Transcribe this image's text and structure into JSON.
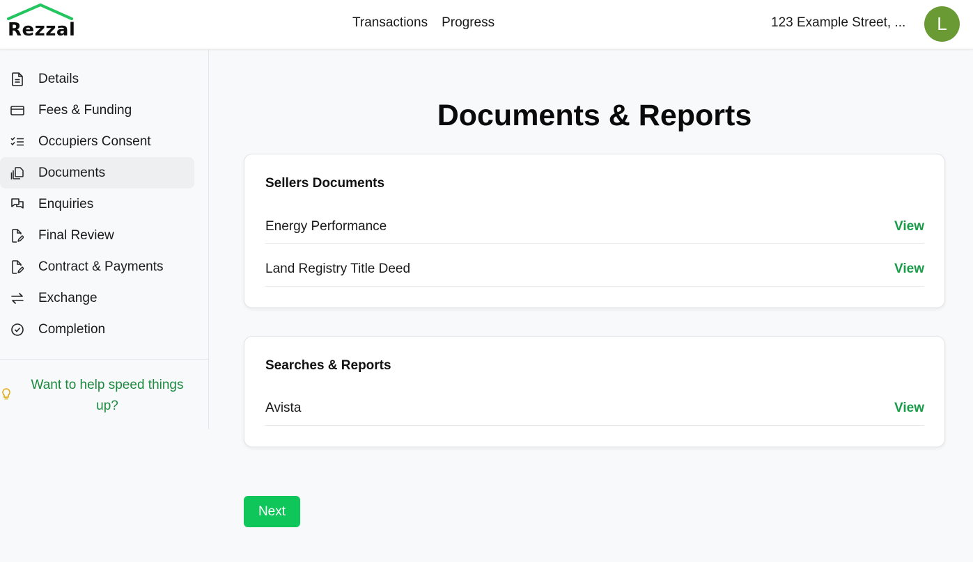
{
  "header": {
    "logo_text": "Rezzal",
    "nav": [
      "Transactions",
      "Progress"
    ],
    "address": "123 Example Street, ...",
    "avatar_initial": "L"
  },
  "sidebar": {
    "items": [
      {
        "label": "Details",
        "icon": "document-icon"
      },
      {
        "label": "Fees & Funding",
        "icon": "credit-card-icon"
      },
      {
        "label": "Occupiers Consent",
        "icon": "checklist-icon"
      },
      {
        "label": "Documents",
        "icon": "documents-icon",
        "active": true
      },
      {
        "label": "Enquiries",
        "icon": "chat-icon"
      },
      {
        "label": "Final Review",
        "icon": "edit-document-icon"
      },
      {
        "label": "Contract & Payments",
        "icon": "edit-document-icon"
      },
      {
        "label": "Exchange",
        "icon": "exchange-arrows-icon"
      },
      {
        "label": "Completion",
        "icon": "check-circle-icon"
      }
    ],
    "help_text": "Want to help speed things up?"
  },
  "main": {
    "title": "Documents & Reports",
    "sections": [
      {
        "title": "Sellers Documents",
        "rows": [
          {
            "name": "Energy Performance",
            "action": "View"
          },
          {
            "name": "Land Registry Title Deed",
            "action": "View"
          }
        ]
      },
      {
        "title": "Searches & Reports",
        "rows": [
          {
            "name": "Avista",
            "action": "View"
          }
        ]
      }
    ],
    "next_label": "Next"
  },
  "colors": {
    "brand_green": "#0fc65a",
    "link_green": "#1a9c4a",
    "avatar_green": "#6a9a34",
    "bulb_yellow": "#e0a400"
  }
}
